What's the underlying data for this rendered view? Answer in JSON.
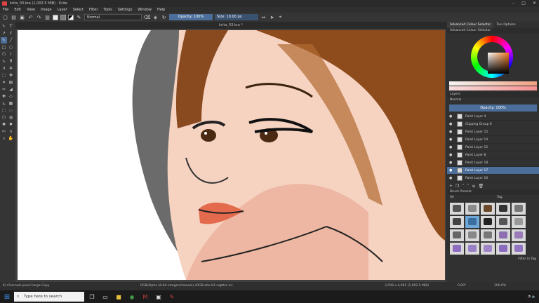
{
  "window": {
    "title": "krita_03.kra (1,002.5 MiB) - Krita",
    "controls": [
      "–",
      "□",
      "✕"
    ]
  },
  "menu": [
    "File",
    "Edit",
    "View",
    "Image",
    "Layer",
    "Select",
    "Filter",
    "Tools",
    "Settings",
    "Window",
    "Help"
  ],
  "toolbar": {
    "blend_mode": "Normal",
    "opacity": "Opacity: 100%",
    "size": "Size: 10.00 px"
  },
  "canvas": {
    "doc_tab": "krita_03.kra *"
  },
  "docker": {
    "tabs": [
      "Advanced Colour Selector",
      "Tool Options"
    ],
    "color_title": "Advanced Colour Selector",
    "layers_title": "Layers",
    "layers_blend": "Normal",
    "layers_opacity": "Opacity: 100%",
    "layers": [
      {
        "name": "Paint Layer 4",
        "selected": false
      },
      {
        "name": "Clipping Group 6",
        "selected": false
      },
      {
        "name": "Paint Layer 15",
        "selected": false
      },
      {
        "name": "Paint Layer 14",
        "selected": false
      },
      {
        "name": "Paint Layer 12",
        "selected": false
      },
      {
        "name": "Paint Layer 8",
        "selected": false
      },
      {
        "name": "Paint Layer 18",
        "selected": false
      },
      {
        "name": "Paint Layer 17",
        "selected": true
      },
      {
        "name": "Paint Layer 10",
        "selected": false
      }
    ],
    "brush_title": "Brush Presets",
    "brush_filter": "All",
    "brush_tag": "Tag",
    "filter_label": "Filter in Tag"
  },
  "status": {
    "brush": "K) Charcoal pencil large Copy",
    "color": "RGB/Alpha (8-bit integer/channel) sRGB-elle-V2-srgbtrc.icc",
    "size": "3,508 x 4,961 (1,002.5 MiB)",
    "rotation": "0.00°",
    "zoom": "100.0%"
  },
  "taskbar": {
    "search_placeholder": "Type here to search"
  }
}
